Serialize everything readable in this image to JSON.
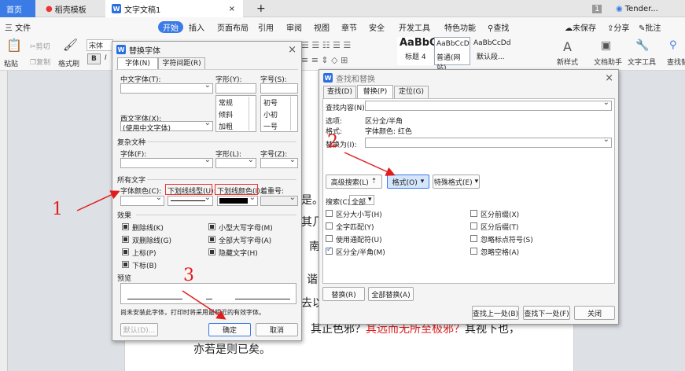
{
  "tabs": {
    "home": "首页",
    "template": "稻壳模板",
    "doc": "文字文稿1",
    "add": "+",
    "num": "1",
    "user": "Tender..."
  },
  "menu": {
    "file": "三 文件",
    "items": [
      "开始",
      "插入",
      "页面布局",
      "引用",
      "审阅",
      "视图",
      "章节",
      "安全",
      "开发工具",
      "特色功能"
    ],
    "search": "查找",
    "unsaved": "未保存",
    "share": "分享",
    "comment": "批注"
  },
  "ribbon": {
    "paste": "粘贴",
    "cut": "剪切",
    "copy": "复制",
    "format_painter": "格式刷",
    "font": "宋体",
    "bold": "B",
    "italic": "I",
    "styles": [
      {
        "label": "AaBbC",
        "name": "标题 4"
      },
      {
        "label": "AaBbCcD",
        "name": "普通(网站)"
      },
      {
        "label": "AaBbCcDd",
        "name": "默认段..."
      }
    ],
    "new_style": "新样式",
    "doc_assist": "文档助手",
    "text_tool": "文字工具",
    "find_replace": "查找替"
  },
  "doc": {
    "lines": [
      "其几",
      "南",
      "谐",
      "去以"
    ],
    "tail_mark": "是。",
    "line_main_black": "其正色邪？",
    "line_main_red": "其远而无所至极邪？",
    "line_main_end": "其视下也，",
    "line_last": "亦若是则已矣。"
  },
  "font_dialog": {
    "title": "替换字体",
    "tabs": [
      "字体(N)",
      "字符间距(R)"
    ],
    "cn_font": "中文字体(T):",
    "style": "字形(Y):",
    "size": "字号(S):",
    "styles": [
      "常规",
      "倾斜",
      "加粗"
    ],
    "sizes": [
      "初号",
      "小初",
      "一号"
    ],
    "west_font": "西文字体(X):",
    "west_value": "(使用中文字体)",
    "complex": "复杂文种",
    "cfont": "字体(F):",
    "cstyle": "字形(L):",
    "csize": "字号(Z):",
    "all_text": "所有文字",
    "font_color": "字体颜色(C):",
    "underline": "下划线线型(U):",
    "underline_color": "下划线颜色(I):",
    "emphasis": "着重号:",
    "effects": "效果",
    "effect_items": [
      "删除线(K)",
      "双删除线(G)",
      "上标(P)",
      "下标(B)",
      "小型大写字母(M)",
      "全部大写字母(A)",
      "隐藏文字(H)"
    ],
    "preview": "预览",
    "note": "尚未安装此字体，打印时将采用最相近的有效字体。",
    "default": "默认(D)...",
    "ok": "确定",
    "cancel": "取消"
  },
  "find_dialog": {
    "title": "查找和替换",
    "tabs": [
      "查找(D)",
      "替换(P)",
      "定位(G)"
    ],
    "find_what": "查找内容(N):",
    "options_label": "选项:",
    "options_value": "区分全/半角",
    "format_label": "格式:",
    "format_value": "字体颜色: 红色",
    "replace_with": "替换为(I):",
    "advanced": "高级搜索(L)",
    "format": "格式(O)",
    "special": "特殊格式(E)",
    "search_label": "搜索(C)",
    "search_value": "全部",
    "left_opts": [
      "区分大小写(H)",
      "全字匹配(Y)",
      "使用通配符(U)",
      "区分全/半角(M)"
    ],
    "right_opts": [
      "区分前缀(X)",
      "区分后缀(T)",
      "忽略标点符号(S)",
      "忽略空格(A)"
    ],
    "replace": "替换(R)",
    "replace_all": "全部替换(A)",
    "prev": "查找上一处(B)",
    "next": "查找下一处(F)",
    "close": "关闭"
  },
  "annotations": [
    "1",
    "2",
    "3"
  ],
  "colors": {
    "accent": "#2b6fdf",
    "red": "#e21c1c"
  }
}
